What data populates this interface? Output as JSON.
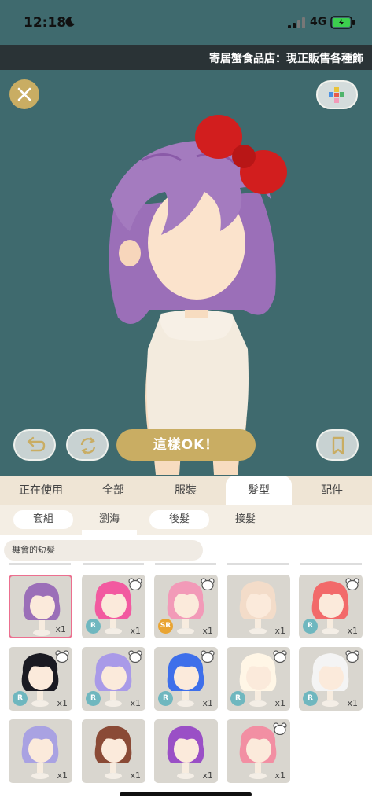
{
  "status_bar": {
    "time": "12:18",
    "network": "4G"
  },
  "marquee": {
    "text": "寄居蟹食品店：現正販售各種飾"
  },
  "stage": {
    "ok_button": "這樣OK！"
  },
  "tabs": [
    {
      "label": "正在使用"
    },
    {
      "label": "全部"
    },
    {
      "label": "服裝"
    },
    {
      "label": "髮型"
    },
    {
      "label": "配件"
    }
  ],
  "subtabs": [
    {
      "label": "套組"
    },
    {
      "label": "瀏海"
    },
    {
      "label": "後髮"
    },
    {
      "label": "接髮"
    }
  ],
  "set_name": "舞會的短髮",
  "items": [
    {
      "qty": "x1",
      "rarity": "",
      "hair_color": "#9b6fb8",
      "selected": true
    },
    {
      "qty": "x1",
      "rarity": "R",
      "hair_color": "#f25aa0"
    },
    {
      "qty": "x1",
      "rarity": "SR",
      "hair_color": "#f29ab8"
    },
    {
      "qty": "x1",
      "rarity": "",
      "hair_color": "#f3dcc9"
    },
    {
      "qty": "x1",
      "rarity": "R",
      "hair_color": "#f26a6a"
    },
    {
      "qty": "x1",
      "rarity": "R",
      "hair_color": "#1a1a22"
    },
    {
      "qty": "x1",
      "rarity": "R",
      "hair_color": "#a99ae8"
    },
    {
      "qty": "x1",
      "rarity": "R",
      "hair_color": "#3e6fea"
    },
    {
      "qty": "x1",
      "rarity": "R",
      "hair_color": "#fff6e6"
    },
    {
      "qty": "x1",
      "rarity": "R",
      "hair_color": "#f4f4f4"
    },
    {
      "qty": "x1",
      "rarity": "",
      "hair_color": "#a9a2e2"
    },
    {
      "qty": "x1",
      "rarity": "",
      "hair_color": "#8a4a36"
    },
    {
      "qty": "x1",
      "rarity": "",
      "hair_color": "#9a4fc6"
    },
    {
      "qty": "x1",
      "rarity": "",
      "hair_color": "#f28fa3"
    }
  ],
  "colors": {
    "accent": "#c9ad63",
    "stage_bg": "#3f6a6e",
    "selected_border": "#ec6f8f",
    "rarity_r": "#6fb7bf",
    "rarity_sr": "#e9a432"
  }
}
